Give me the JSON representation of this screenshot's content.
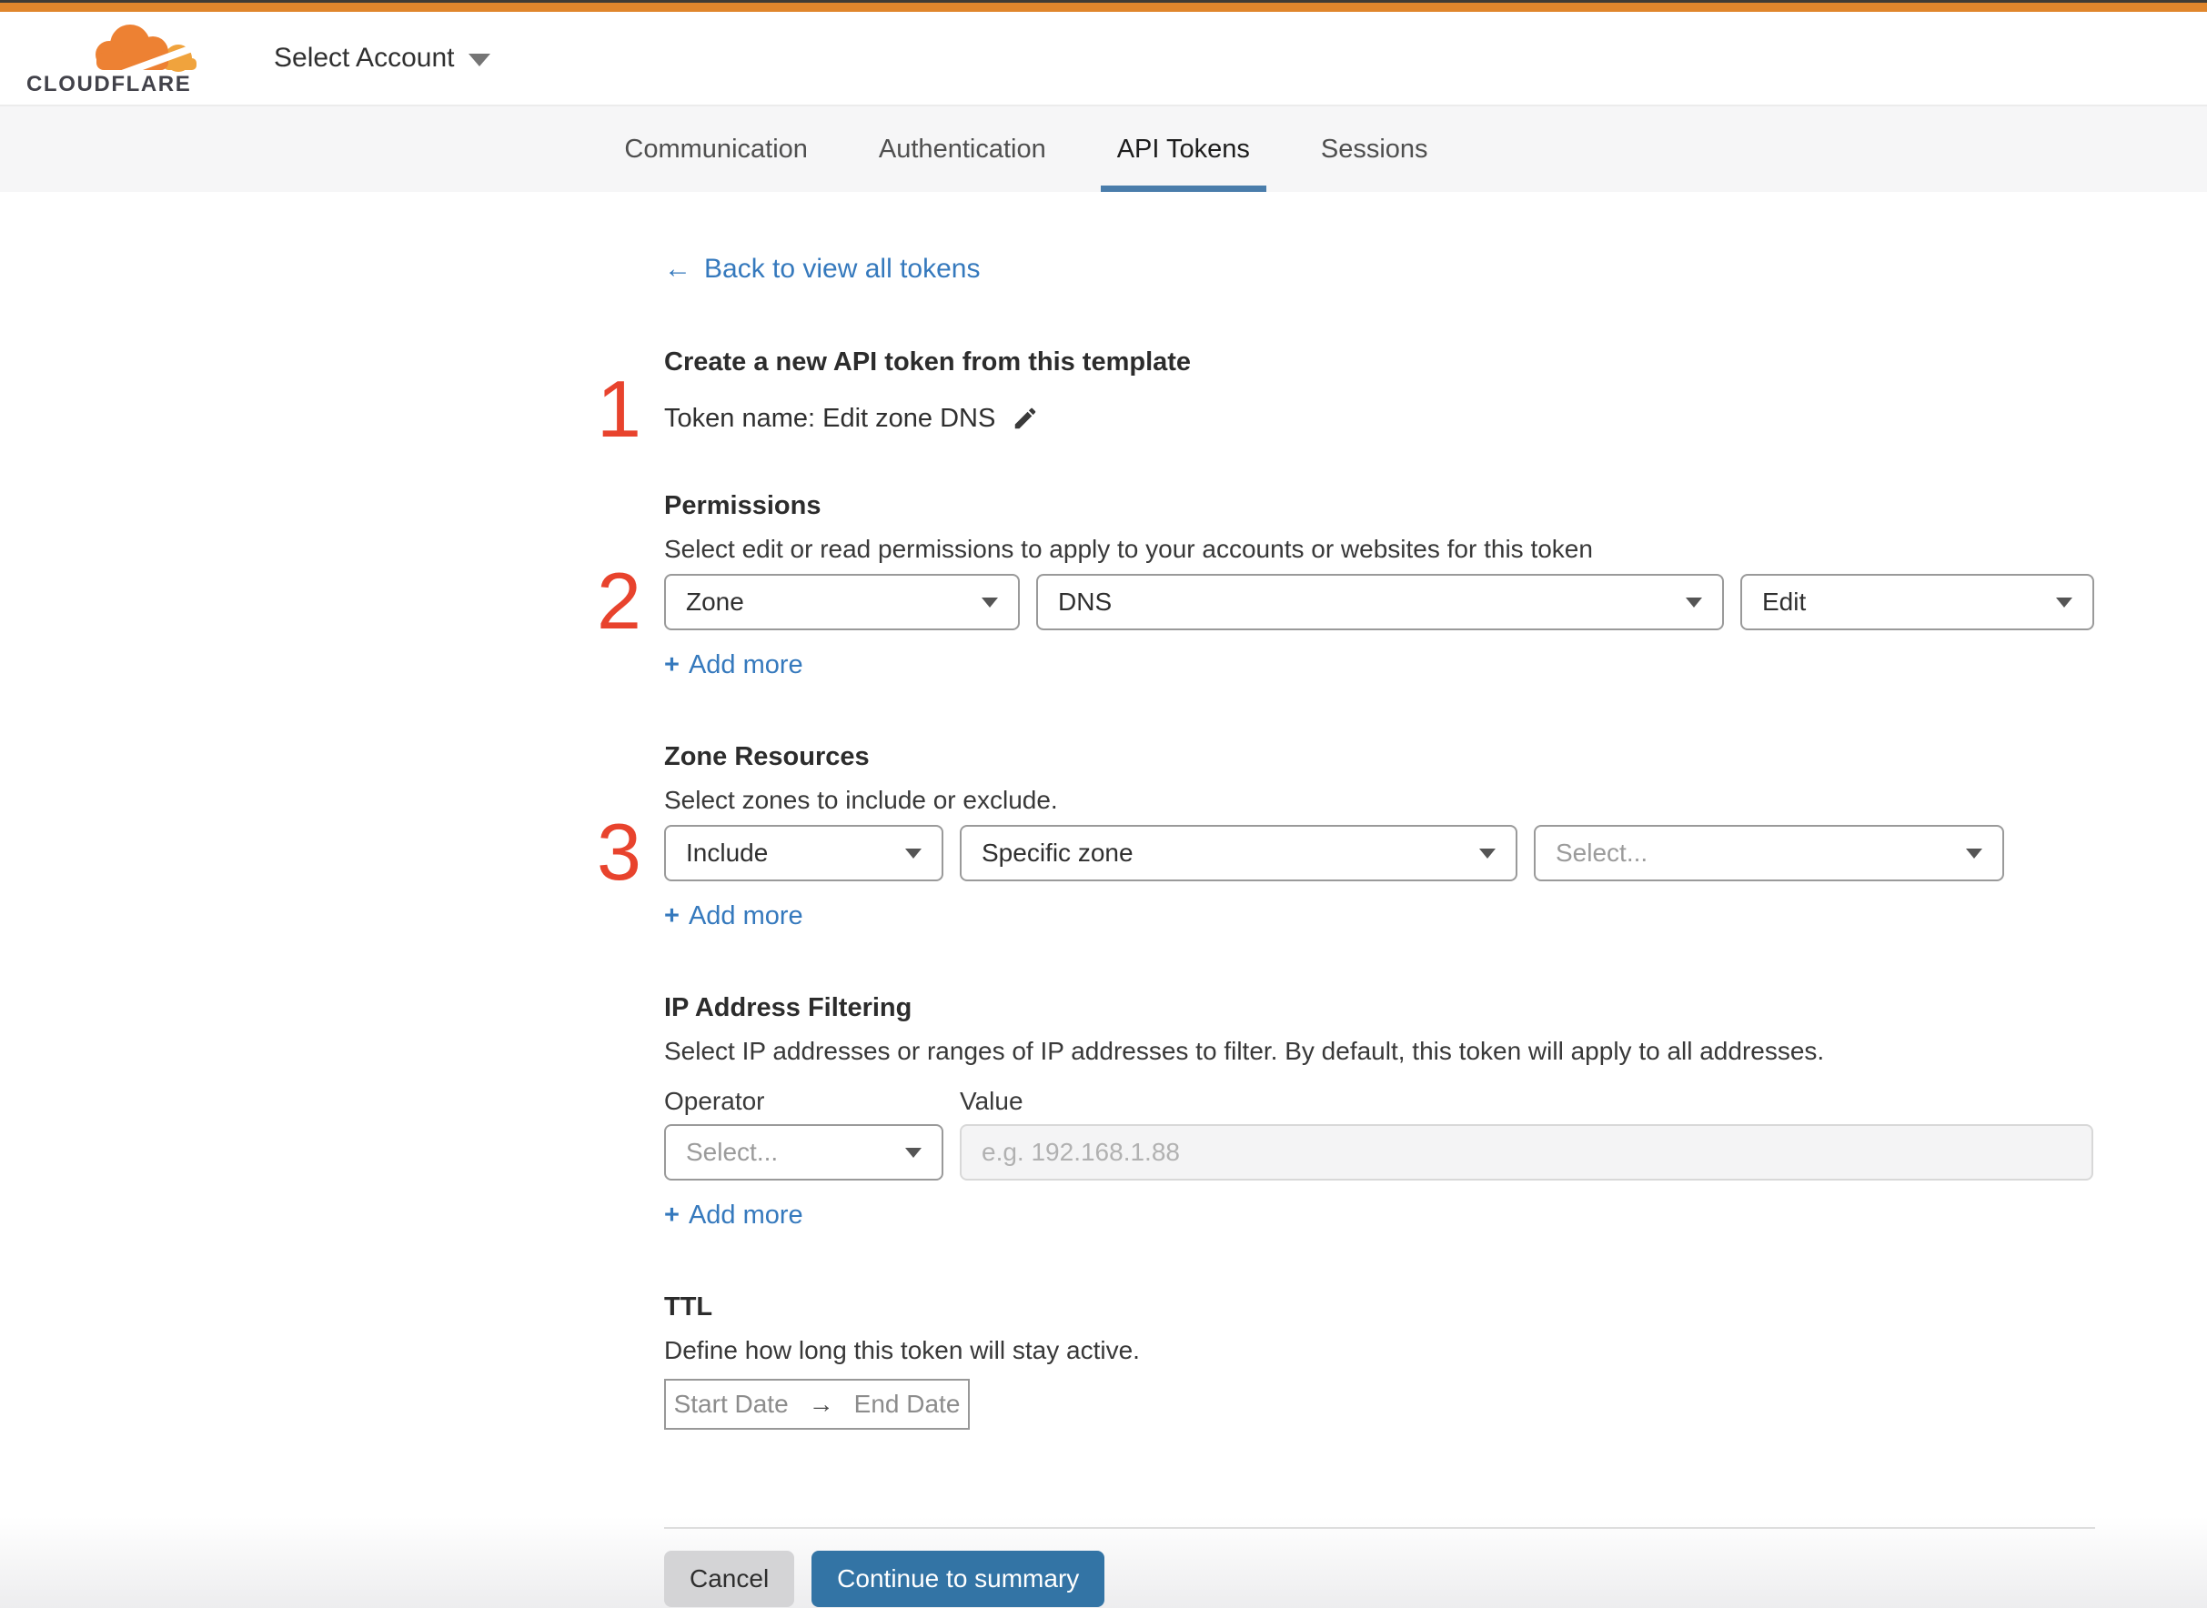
{
  "header": {
    "logo": {
      "wordmark": "CLOUDFLARE"
    },
    "account_selector": {
      "label": "Select Account"
    }
  },
  "tabs": {
    "items": [
      {
        "label": "Communication",
        "active": false
      },
      {
        "label": "Authentication",
        "active": false
      },
      {
        "label": "API Tokens",
        "active": true
      },
      {
        "label": "Sessions",
        "active": false
      }
    ]
  },
  "back_link": {
    "arrow": "←",
    "label": "Back to view all tokens"
  },
  "token_template": {
    "step_number": "1",
    "title": "Create a new API token from this template",
    "token_name": "Token name: Edit zone DNS"
  },
  "permissions": {
    "step_number": "2",
    "title": "Permissions",
    "description": "Select edit or read permissions to apply to your accounts or websites for this token",
    "scope_value": "Zone",
    "permission_value": "DNS",
    "access_value": "Edit",
    "plus": "+",
    "add_more": "Add more"
  },
  "zone_resources": {
    "step_number": "3",
    "title": "Zone Resources",
    "description": "Select zones to include or exclude.",
    "mode_value": "Include",
    "type_value": "Specific zone",
    "zone_placeholder": "Select...",
    "plus": "+",
    "add_more": "Add more"
  },
  "ip_filtering": {
    "title": "IP Address Filtering",
    "description": "Select IP addresses or ranges of IP addresses to filter. By default, this token will apply to all addresses.",
    "operator_label": "Operator",
    "value_label": "Value",
    "operator_placeholder": "Select...",
    "value_placeholder": "e.g. 192.168.1.88",
    "plus": "+",
    "add_more": "Add more"
  },
  "ttl": {
    "title": "TTL",
    "description": "Define how long this token will stay active.",
    "start_date_label": "Start Date",
    "arrow": "→",
    "end_date_label": "End Date"
  },
  "actions": {
    "cancel": "Cancel",
    "continue": "Continue to summary"
  },
  "colors": {
    "topbar_orange": "#e0862c",
    "brand_orange": "#ed8133",
    "brand_orange_light": "#f0a33d",
    "link_blue": "#3579bd",
    "tab_underline_blue": "#4a7dab",
    "step_number_red": "#e8432d",
    "primary_button_blue": "#3374a5"
  }
}
